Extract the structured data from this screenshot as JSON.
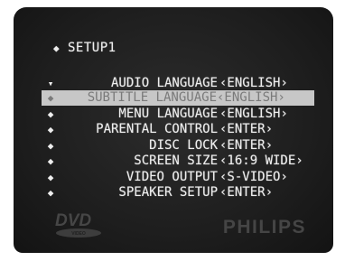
{
  "menu": {
    "title": "SETUP1",
    "title_bullet": "◆",
    "items": [
      {
        "bullet": "▾",
        "label": "AUDIO LANGUAGE",
        "value": "‹ENGLISH›"
      },
      {
        "bullet": "◆",
        "label": "SUBTITLE LANGUAGE",
        "value": "‹ENGLISH›"
      },
      {
        "bullet": "◆",
        "label": "MENU LANGUAGE",
        "value": "‹ENGLISH›"
      },
      {
        "bullet": "◆",
        "label": "PARENTAL CONTROL",
        "value": "‹ENTER›"
      },
      {
        "bullet": "◆",
        "label": "DISC LOCK",
        "value": "‹ENTER›"
      },
      {
        "bullet": "◆",
        "label": "SCREEN SIZE",
        "value": "‹16:9 WIDE›"
      },
      {
        "bullet": "◆",
        "label": "VIDEO OUTPUT",
        "value": "‹S-VIDEO›"
      },
      {
        "bullet": "◆",
        "label": "SPEAKER SETUP",
        "value": "‹ENTER›"
      }
    ],
    "selected_index": 1
  },
  "branding": {
    "left_logo": "DVD",
    "left_logo_sub": "VIDEO",
    "right_logo": "PHILIPS"
  },
  "colors": {
    "screen_bg": "#1e1e1e",
    "text": "#eeeeee",
    "highlight_bg": "#c7c7c7",
    "highlight_text": "#7a7a7a",
    "logo": "#454545"
  }
}
